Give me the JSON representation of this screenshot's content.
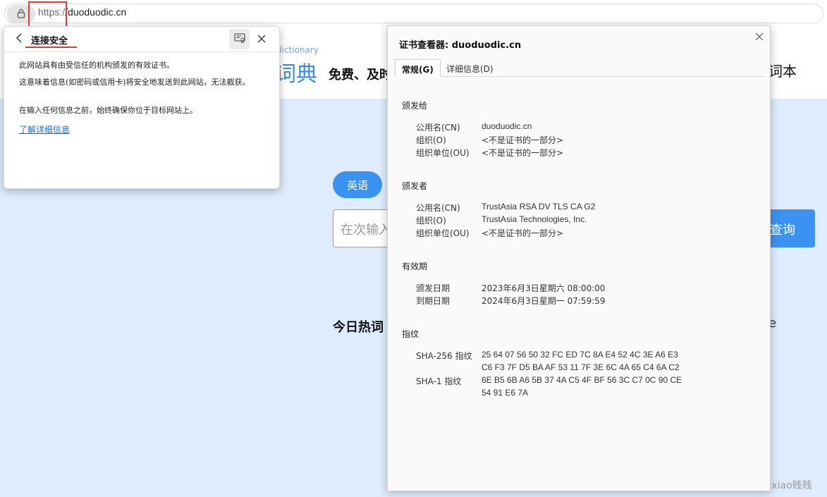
{
  "address_bar": {
    "url_scheme": "https:/",
    "url_host": "/duoduodic.cn"
  },
  "site": {
    "logo_subtitle": "dictionary",
    "logo_text": "词典",
    "slogan": "免费、及时",
    "vocab_label": "词本",
    "lang_button": "英语",
    "search_placeholder": "在次输入",
    "search_button": "查询",
    "hot_words_title": "今日热词",
    "hot_word_fragment": "e"
  },
  "flyout": {
    "title": "连接安全",
    "p1": "此网站具有由受信任的机构颁发的有效证书。",
    "p2": "这意味着信息(如密码或信用卡)将安全地发送到此网站，无法截获。",
    "p3": "在输入任何信息之前，始终确保你位于目标网站上。",
    "learn_more": "了解详细信息"
  },
  "viewer": {
    "title": "证书查看器: duoduodic.cn",
    "tabs": [
      "常规(G)",
      "详细信息(D)"
    ],
    "issued_to": {
      "heading": "颁发给",
      "cn_label": "公用名(CN)",
      "cn_value": "duoduodic.cn",
      "o_label": "组织(O)",
      "o_value": "<不是证书的一部分>",
      "ou_label": "组织单位(OU)",
      "ou_value": "<不是证书的一部分>"
    },
    "issued_by": {
      "heading": "颁发者",
      "cn_label": "公用名(CN)",
      "cn_value": "TrustAsia RSA DV TLS CA G2",
      "o_label": "组织(O)",
      "o_value": "TrustAsia Technologies, Inc.",
      "ou_label": "组织单位(OU)",
      "ou_value": "<不是证书的一部分>"
    },
    "validity": {
      "heading": "有效期",
      "issued_label": "颁发日期",
      "issued_value": "2023年6月3日星期六 08:00:00",
      "expires_label": "到期日期",
      "expires_value": "2024年6月3日星期一 07:59:59"
    },
    "fingerprints": {
      "heading": "指纹",
      "sha256_label": "SHA-256 指纹",
      "sha256_line1": "25 64 07 56 50 32 FC ED 7C 8A E4 52 4C 3E A6 E3",
      "sha256_line2": "C6 F3 7F D5 BA AF 53 11 7F 3E 6C 4A 65 C4 6A C2",
      "sha1_label": "SHA-1 指纹",
      "sha1_line1": "6E B5 6B A6 5B 37 4A C5 4F BF 56 3C C7 0C 90 CE",
      "sha1_line2": "54 91 E6 7A"
    }
  },
  "watermark": "CSDN @xiao贱贱"
}
